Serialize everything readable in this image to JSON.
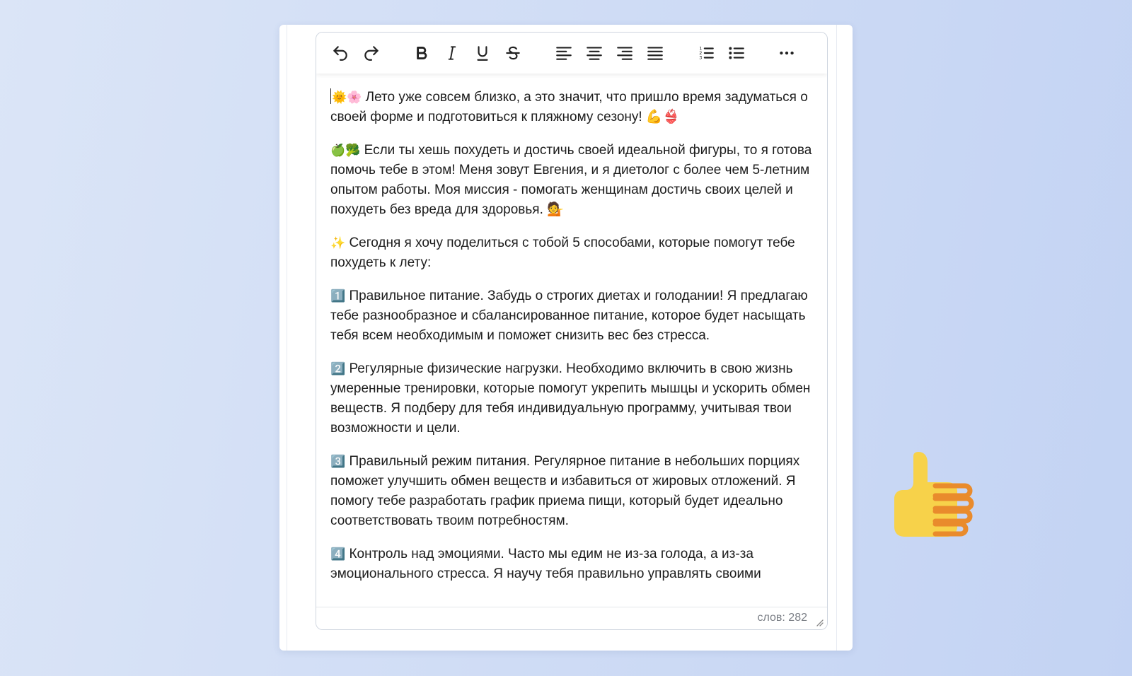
{
  "toolbar": {
    "buttons": [
      "undo-icon",
      "redo-icon",
      "bold-icon",
      "italic-icon",
      "underline-icon",
      "strikethrough-icon",
      "align-left-icon",
      "align-center-icon",
      "align-right-icon",
      "align-justify-icon",
      "numbered-list-icon",
      "bulleted-list-icon",
      "more-icon"
    ]
  },
  "content": {
    "paragraphs": [
      {
        "emoji": "🌞🌸",
        "text": "Лето уже совсем близко, а это значит, что пришло время задуматься о своей форме и подготовиться к пляжному сезону! 💪👙"
      },
      {
        "emoji": "🍏🥦",
        "text": "Если ты хешь похудеть и достичь своей идеальной фигуры, то я готова помочь тебе в этом! Меня зовут Евгения, и я диетолог с более чем 5-летним опытом работы. Моя миссия - помогать женщинам достичь своих целей и похудеть без вреда для здоровья. 💁"
      },
      {
        "emoji": "✨",
        "text": "Сегодня я хочу поделиться с тобой 5 способами, которые помогут тебе похудеть к лету:"
      },
      {
        "emoji": "1️⃣",
        "text": "Правильное питание. Забудь о строгих диетах и голодании! Я предлагаю тебе разнообразное и сбалансированное питание, которое будет насыщать тебя всем необходимым и поможет снизить вес без стресса."
      },
      {
        "emoji": "2️⃣",
        "text": "Регулярные физические нагрузки. Необходимо включить в свою жизнь умеренные тренировки, которые помогут укрепить мышцы и ускорить обмен веществ. Я подберу для тебя индивидуальную программу, учитывая твои возможности и цели."
      },
      {
        "emoji": "3️⃣",
        "text": "Правильный режим питания. Регулярное питание в небольших порциях поможет улучшить обмен веществ и избавиться от жировых отложений. Я помогу тебе разработать график приема пищи, который будет идеально соответствовать твоим потребностям."
      },
      {
        "emoji": "4️⃣",
        "text": "Контроль над эмоциями. Часто мы едим не из-за голода, а из-за эмоционального стресса. Я научу тебя правильно управлять своими"
      }
    ]
  },
  "statusbar": {
    "word_count": "слов: 282"
  },
  "decor": {
    "thumb": "thumbs-up-icon"
  }
}
